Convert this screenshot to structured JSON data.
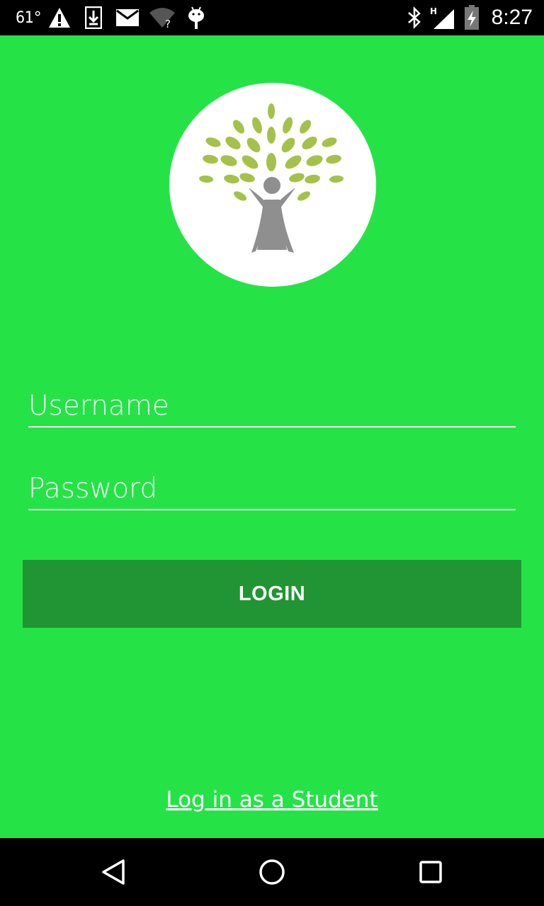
{
  "status_bar": {
    "temperature": "61°",
    "time": "8:27",
    "icons": [
      "warning-icon",
      "download-icon",
      "mail-icon",
      "wifi-unknown-icon",
      "android-debug-icon",
      "bluetooth-icon",
      "signal-h-icon",
      "battery-charging-icon"
    ]
  },
  "app": {
    "background_color": "#25e347",
    "logo": "tree-person-logo",
    "username": {
      "placeholder": "Username",
      "value": ""
    },
    "password": {
      "placeholder": "Password",
      "value": ""
    },
    "login_button": {
      "label": "LOGIN",
      "color": "#219533"
    },
    "student_link": "Log in as a Student"
  },
  "nav_bar": {
    "icons": [
      "back-icon",
      "home-icon",
      "recents-icon"
    ]
  }
}
